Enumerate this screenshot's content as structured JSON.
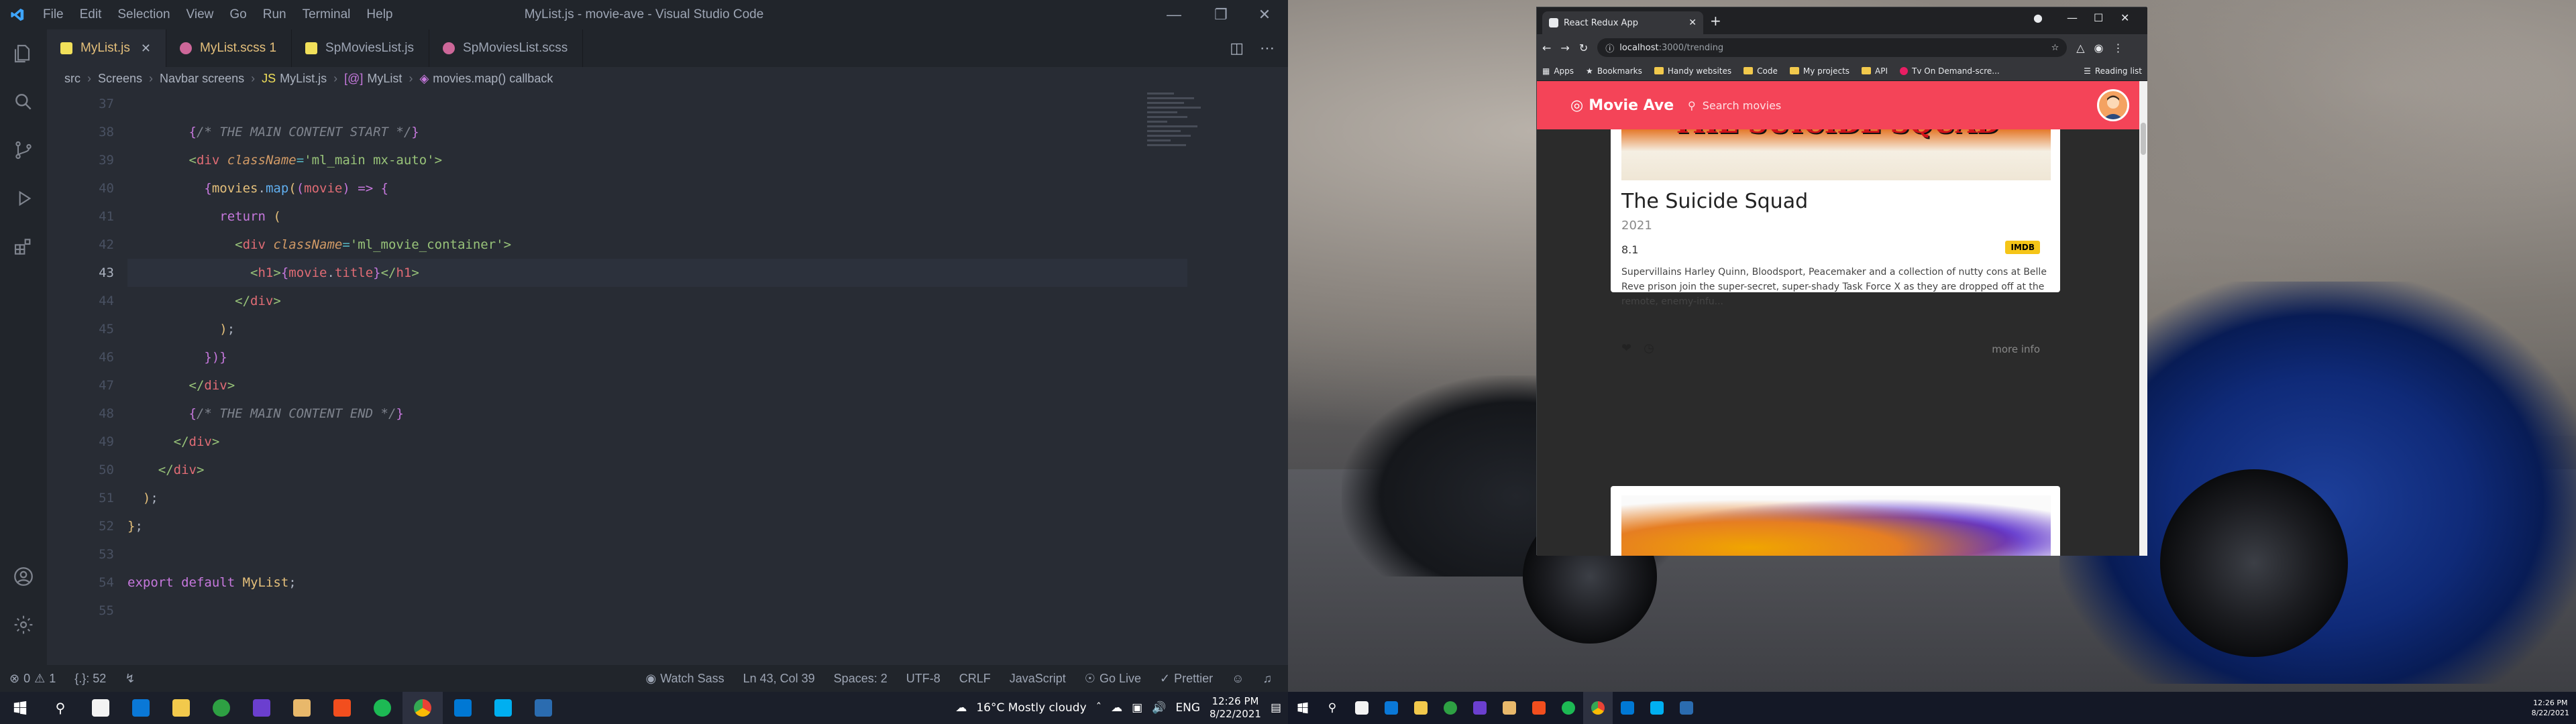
{
  "vscode": {
    "title": "MyList.js - movie-ave - Visual Studio Code",
    "menu": [
      "File",
      "Edit",
      "Selection",
      "View",
      "Go",
      "Run",
      "Terminal",
      "Help"
    ],
    "tabs": [
      {
        "label": "MyList.js",
        "active": true,
        "color": "#e5c07b"
      },
      {
        "label": "MyList.scss 1",
        "active": false,
        "color": "#e5c07b"
      },
      {
        "label": "SpMoviesList.js",
        "active": false,
        "color": "#9da5b4"
      },
      {
        "label": "SpMoviesList.scss",
        "active": false,
        "color": "#9da5b4"
      }
    ],
    "breadcrumb": [
      "src",
      "Screens",
      "Navbar screens",
      "MyList.js",
      "MyList",
      "movies.map() callback"
    ],
    "line_numbers": [
      "37",
      "38",
      "39",
      "40",
      "41",
      "42",
      "43",
      "44",
      "45",
      "46",
      "47",
      "48",
      "49",
      "50",
      "51",
      "52",
      "53",
      "54",
      "55"
    ],
    "current_line": "43",
    "status": {
      "errors": "0",
      "warnings": "1",
      "selection": "{.}: 52",
      "watch_sass": "Watch Sass",
      "cursor": "Ln 43, Col 39",
      "spaces": "Spaces: 2",
      "encoding": "UTF-8",
      "eol": "CRLF",
      "language": "JavaScript",
      "golive": "Go Live",
      "prettier": "Prettier"
    }
  },
  "chrome": {
    "tab_title": "React Redux App",
    "url_host": "localhost",
    "url_path": ":3000/trending",
    "bookmarks": [
      "Apps",
      "Bookmarks",
      "Handy websites",
      "Code",
      "My projects",
      "API",
      "Tv On Demand-scre...",
      "Reading list"
    ]
  },
  "app": {
    "brand": "Movie Ave",
    "search_placeholder": "Search movies",
    "card": {
      "poster_text": "THE SUICIDE SQUAD",
      "title": "The Suicide Squad",
      "year": "2021",
      "rating": "8.1",
      "badge": "IMDB",
      "description": "Supervillains Harley Quinn, Bloodsport, Peacemaker and a collection of nutty cons at Belle Reve prison join the super-secret, super-shady Task Force X as they are dropped off at the remote, enemy-infu...",
      "more": "more info"
    }
  },
  "taskbar": {
    "weather": "16°C  Mostly cloudy",
    "lang": "ENG",
    "time": "12:26 PM",
    "date": "8/22/2021",
    "time_small": "12:26 PM",
    "date_small": "8/22/2021"
  }
}
